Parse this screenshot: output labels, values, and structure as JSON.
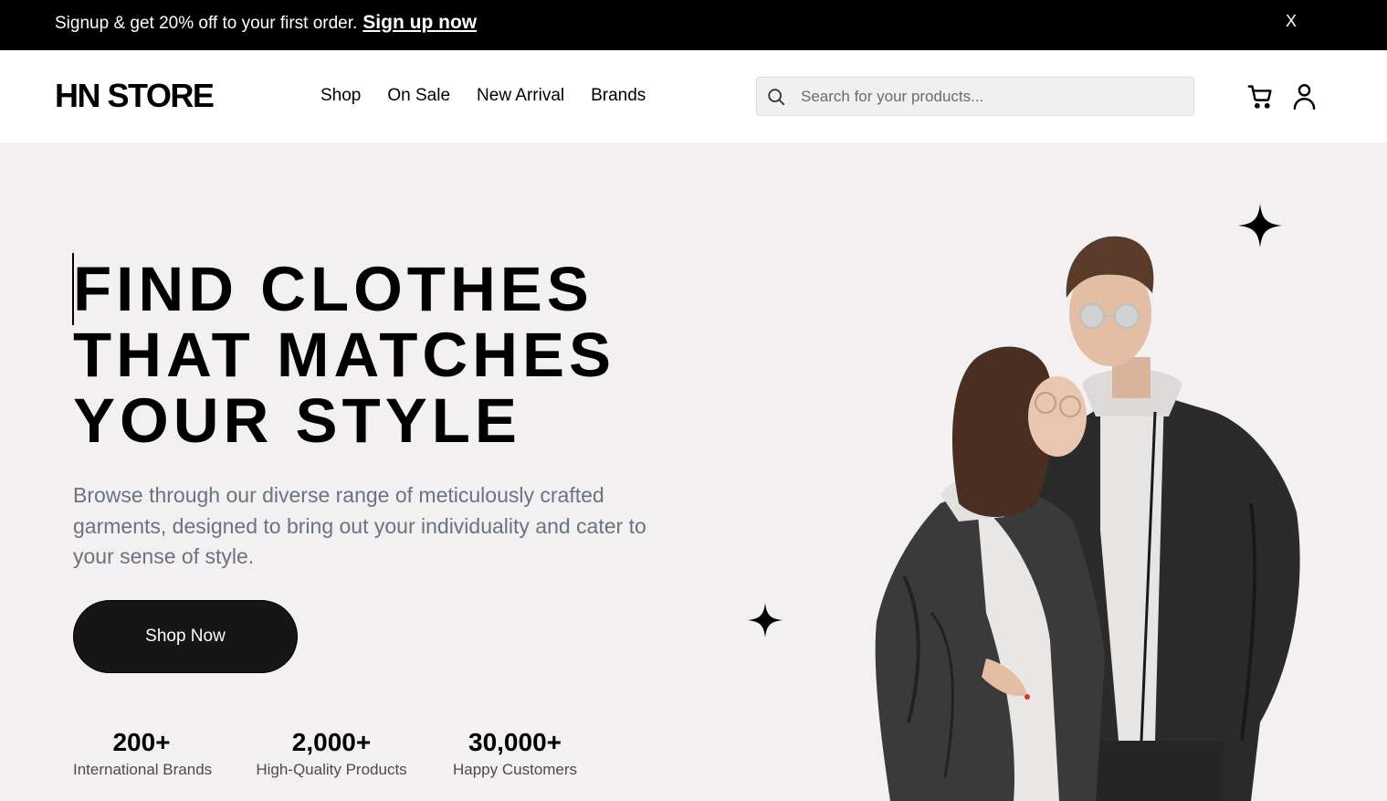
{
  "promo": {
    "text": "Signup & get 20% off to your first order.",
    "link_label": "Sign up now",
    "close_label": "X"
  },
  "header": {
    "logo": "HN STORE",
    "nav": [
      {
        "label": "Shop"
      },
      {
        "label": "On Sale"
      },
      {
        "label": "New Arrival"
      },
      {
        "label": "Brands"
      }
    ],
    "search": {
      "placeholder": "Search for your products..."
    },
    "icons": [
      "search-icon",
      "cart-icon",
      "user-icon"
    ]
  },
  "hero": {
    "headline_lines": [
      "FIND CLOTHES",
      "THAT MATCHES",
      "YOUR STYLE"
    ],
    "description": "Browse through our diverse range of meticulously crafted garments, designed to bring out your individuality and cater to your sense of style.",
    "cta_label": "Shop Now",
    "stats": [
      {
        "value": "200+",
        "label": "International Brands"
      },
      {
        "value": "2,000+",
        "label": "High-Quality Products"
      },
      {
        "value": "30,000+",
        "label": "Happy Customers"
      }
    ],
    "decor_icons": [
      "sparkle-icon"
    ]
  },
  "colors": {
    "promo_bg": "#000000",
    "header_bg": "#ffffff",
    "hero_bg": "#f2f0f1",
    "button_bg": "#161616",
    "muted_text": "#6b7280"
  }
}
